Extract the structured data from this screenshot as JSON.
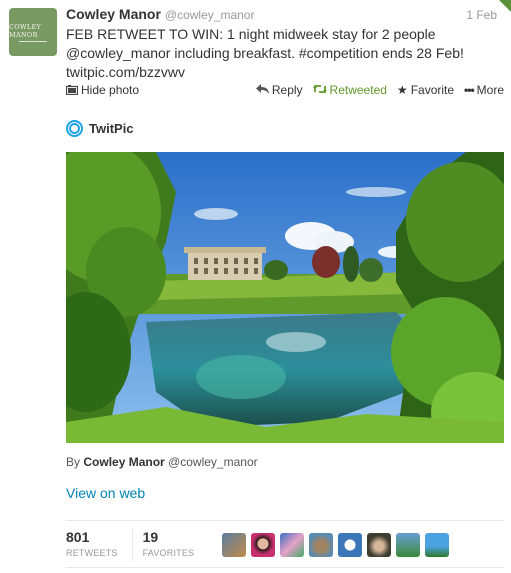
{
  "tweet": {
    "fullname": "Cowley Manor",
    "username": "@cowley_manor",
    "time": "1 Feb",
    "avatar_text": "COWLEY MANOR",
    "text_line1": "FEB RETWEET TO WIN: 1 night midweek stay for 2 people",
    "text_line2": "@cowley_manor including breakfast. #competition ends 28 Feb!",
    "text_line3": "twitpic.com/bzzvwv"
  },
  "actions": {
    "hide_photo": "Hide photo",
    "reply": "Reply",
    "retweeted": "Retweeted",
    "favorite": "Favorite",
    "more": "More"
  },
  "media": {
    "provider": "TwitPic",
    "by_prefix": "By",
    "by_name": "Cowley Manor",
    "by_username": "@cowley_manor",
    "view_on_web": "View on web"
  },
  "stats": {
    "retweets_count": "801",
    "retweets_label": "RETWEETS",
    "favorites_count": "19",
    "favorites_label": "FAVORITES"
  },
  "colors": {
    "link": "#0084b4",
    "retweeted": "#609928",
    "twitpic": "#1aa3e8"
  }
}
